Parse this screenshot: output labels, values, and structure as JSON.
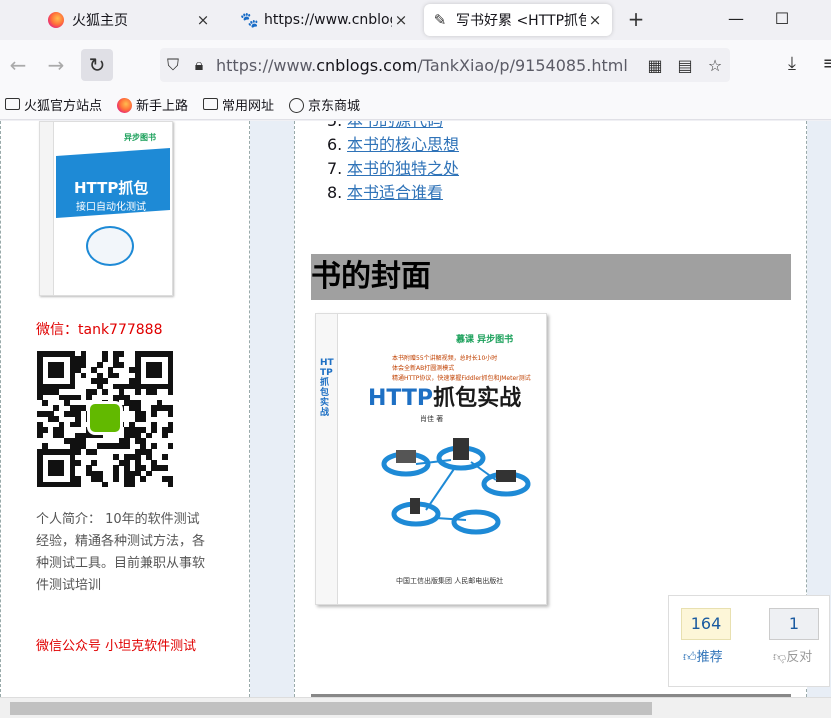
{
  "tabs": [
    {
      "title": "火狐主页",
      "close": "×",
      "active": false
    },
    {
      "title": "https://www.cnblogs.com",
      "close": "×",
      "active": false
    },
    {
      "title": "写书好累 <HTTP抓包实战>",
      "close": "×",
      "active": true
    }
  ],
  "tab_controls": {
    "new_tab": "+",
    "minimize": "—",
    "maximize": "☐"
  },
  "nav": {
    "back": "←",
    "forward": "→",
    "reload": "↻",
    "url_prefix": "https://www.",
    "url_host": "cnblogs.com",
    "url_path": "/TankXiao/p/9154085.html",
    "download": "⤓",
    "menu": "≡"
  },
  "bookmarks": [
    "火狐官方站点",
    "新手上路",
    "常用网址",
    "京东商城"
  ],
  "sidebar": {
    "book1_title": "HTTP抓包",
    "book1_subtitle": "接口自动化测试",
    "book1_logo": "异步图书",
    "wechat": "微信：tank777888",
    "bio": "个人简介： 10年的软件测试经验，精通各种测试方法，各种测试工具。目前兼职从事软件测试培训",
    "wechat_public": "微信公众号 小坦克软件测试"
  },
  "main": {
    "toc": [
      {
        "num": "5.",
        "text": "本书的源代码"
      },
      {
        "num": "6.",
        "text": "本书的核心思想"
      },
      {
        "num": "7.",
        "text": "本书的独特之处"
      },
      {
        "num": "8.",
        "text": "本书适合谁看"
      }
    ],
    "section_title": "书的封面",
    "book2_title_en": "HTTP",
    "book2_title_cn": "抓包实战",
    "book2_author": "肖佳 著",
    "book2_spine": "HTTP抓包实战",
    "book2_logos": "慕课 异步图书",
    "book2_blurb": "本书附赠55个讲解视频，总时长10小时\n体会全新AB打圆测模式\n精通HTTP协议，快速掌握Fiddler抓包和JMeter测试",
    "book2_publisher": "中国工信出版集团 人民邮电出版社"
  },
  "vote": {
    "digg_count": "164",
    "bury_count": "1",
    "digg_label": "推荐",
    "bury_label": "反对"
  }
}
